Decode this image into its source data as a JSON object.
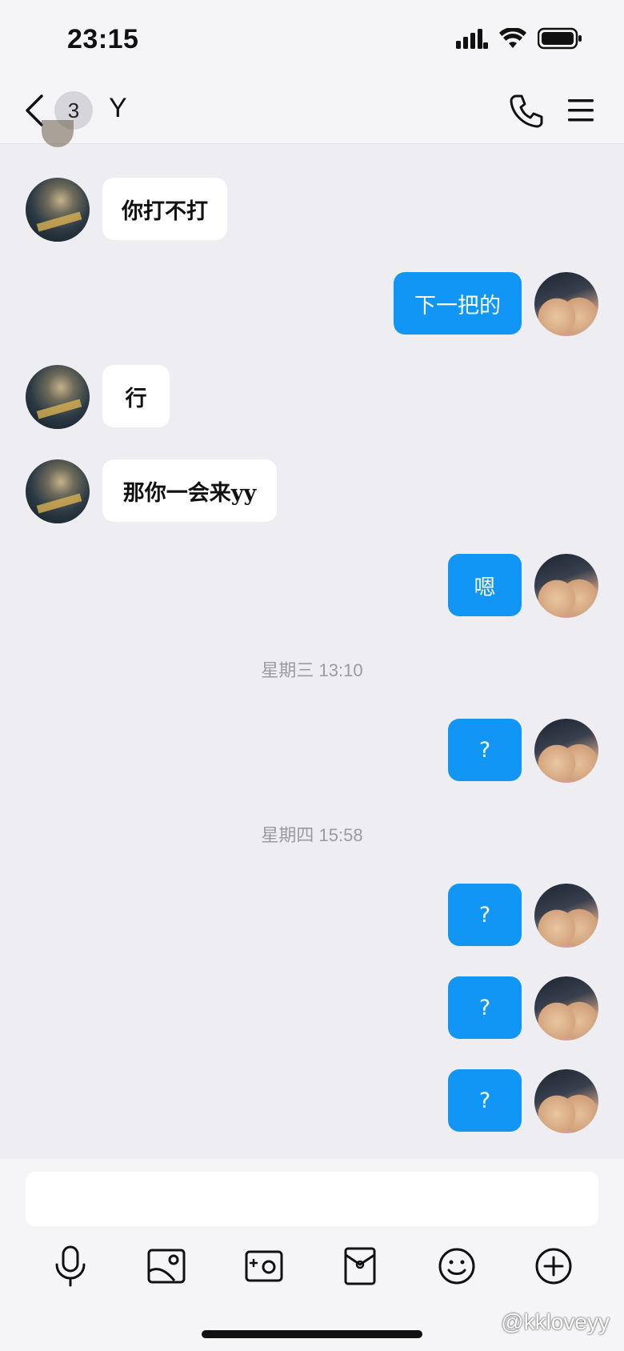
{
  "status_bar": {
    "time": "23:15"
  },
  "header": {
    "unread_count": "3",
    "title": "Y"
  },
  "messages": [
    {
      "side": "in",
      "text": "你打不打"
    },
    {
      "side": "out",
      "text": "下一把的"
    },
    {
      "side": "in",
      "text": "行"
    },
    {
      "side": "in",
      "text": "那你一会来yy"
    },
    {
      "side": "out",
      "text": "嗯"
    },
    {
      "side": "out",
      "text": "?"
    },
    {
      "side": "out",
      "text": "?"
    },
    {
      "side": "out",
      "text": "?"
    },
    {
      "side": "out",
      "text": "?"
    }
  ],
  "timestamps": [
    "星期三 13:10",
    "星期四 15:58"
  ],
  "composer": {
    "placeholder": "",
    "tools": [
      "microphone-icon",
      "image-icon",
      "camera-icon",
      "red-packet-icon",
      "emoji-icon",
      "plus-icon"
    ]
  },
  "watermark": "@kkloveyy",
  "colors": {
    "outgoing_bubble": "#1296f6",
    "incoming_bubble": "#ffffff",
    "background": "#ededf2"
  }
}
